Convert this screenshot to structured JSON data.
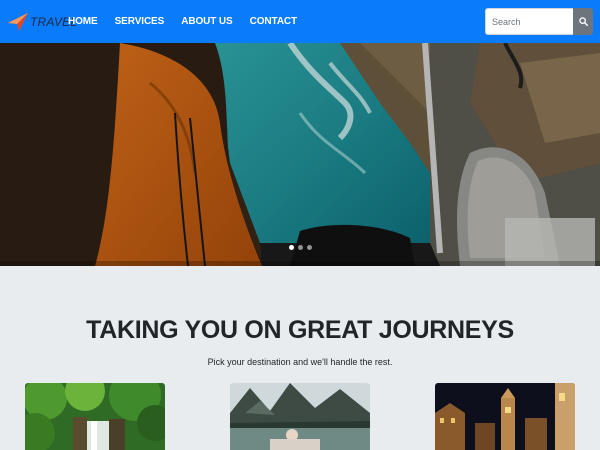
{
  "brand": {
    "name": "TRAVEL",
    "logo_icon": "paper-plane-icon"
  },
  "nav": {
    "items": [
      {
        "label": "HOME"
      },
      {
        "label": "SERVICES"
      },
      {
        "label": "ABOUT US"
      },
      {
        "label": "CONTACT"
      }
    ]
  },
  "search": {
    "placeholder": "Search",
    "value": "",
    "button_icon": "search-icon"
  },
  "carousel": {
    "slide_count": 3,
    "active_index": 0
  },
  "section": {
    "title": "TAKING YOU ON GREAT JOURNEYS",
    "subtitle": "Pick your destination and we'll handle the rest."
  },
  "colors": {
    "navbar": "#0a7bfb",
    "page_background": "#e9ecef",
    "search_button": "#6c757d"
  }
}
